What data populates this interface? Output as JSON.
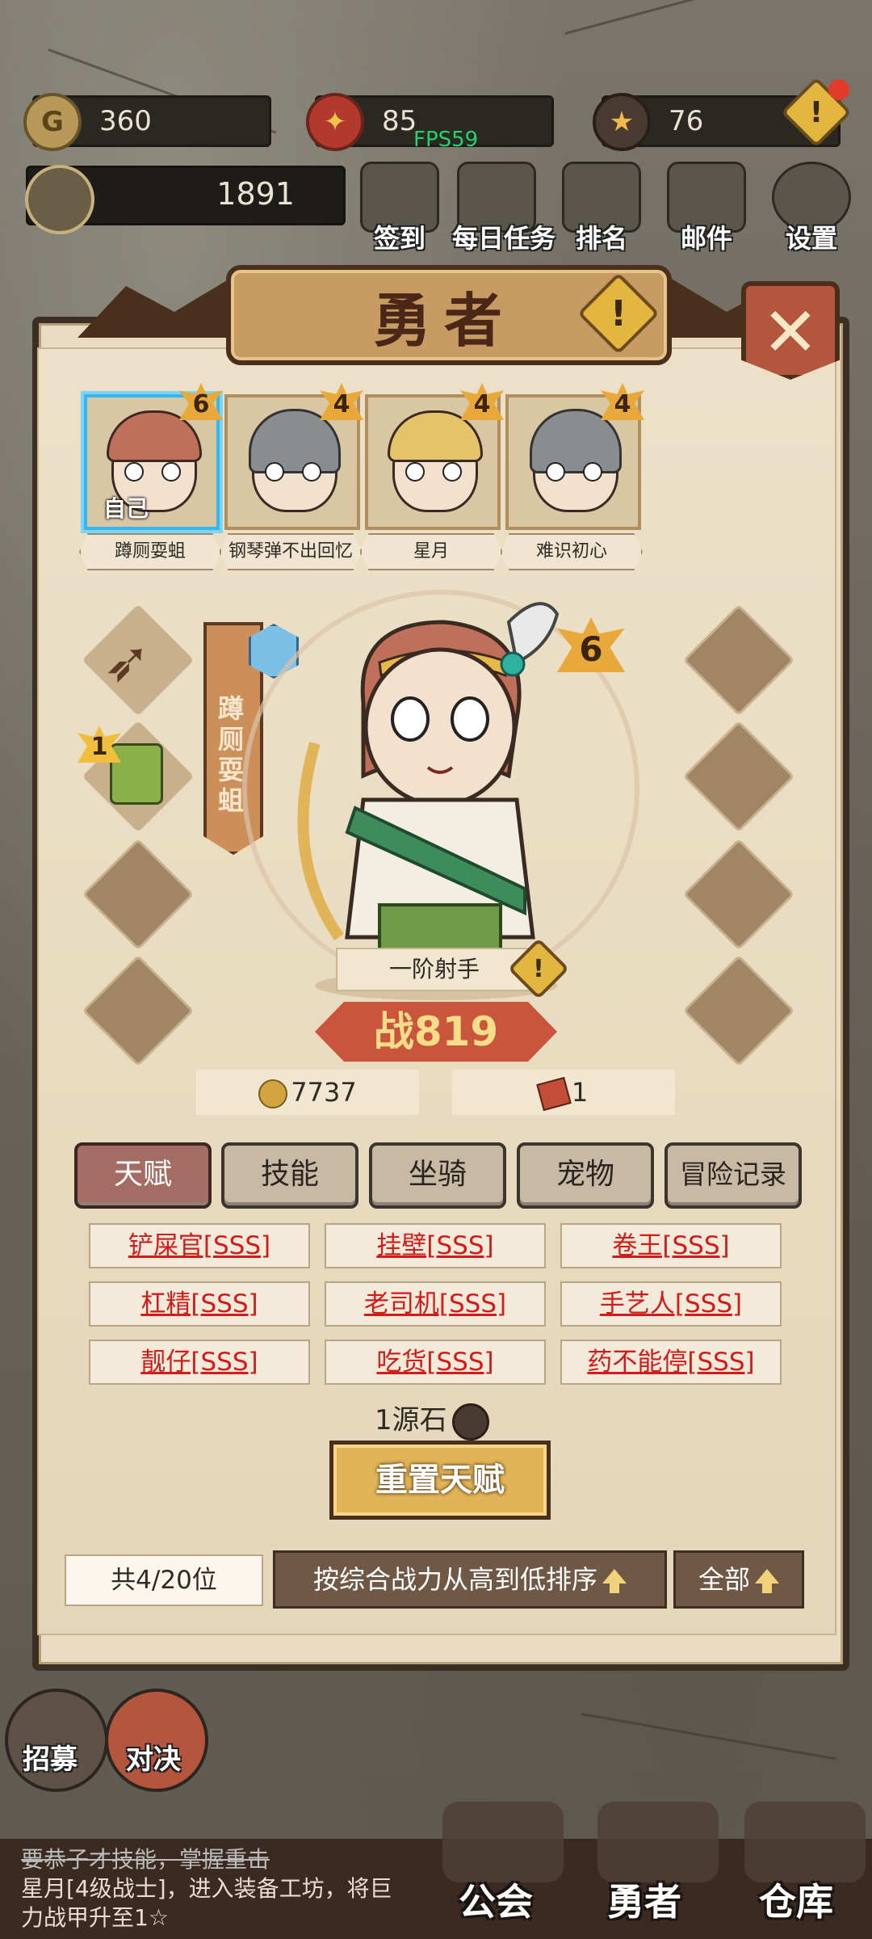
{
  "resources": {
    "gold": "360",
    "honor": "85",
    "stone": "76"
  },
  "fps": "FPS59",
  "total_power": "1891",
  "top_menu": [
    "签到",
    "每日任务",
    "排名",
    "邮件",
    "设置"
  ],
  "panel": {
    "title": "勇者",
    "close_icon": "close-icon"
  },
  "heroes": [
    {
      "name": "蹲厕耍蛆",
      "level": "6",
      "tag": "自己",
      "selected": true
    },
    {
      "name": "钢琴弹不出回忆",
      "level": "4",
      "selected": false
    },
    {
      "name": "星月",
      "level": "4",
      "selected": false
    },
    {
      "name": "难识初心",
      "level": "4",
      "selected": false
    }
  ],
  "equipment": {
    "bow_slot": "bow-icon",
    "armor_level": "1"
  },
  "hero_detail": {
    "banner_name": "蹲厕耍蛆",
    "level": "6",
    "class": "一阶射手",
    "battle_prefix": "战",
    "battle_power": "819",
    "gold": "7737",
    "scrolls": "1"
  },
  "tabs": [
    "天赋",
    "技能",
    "坐骑",
    "宠物",
    "冒险记录"
  ],
  "active_tab": "天赋",
  "talents": [
    "铲屎官[SSS]",
    "挂壁[SSS]",
    "卷王[SSS]",
    "杠精[SSS]",
    "老司机[SSS]",
    "手艺人[SSS]",
    "靓仔[SSS]",
    "吃货[SSS]",
    "药不能停[SSS]"
  ],
  "reset": {
    "cost": "1源石",
    "button": "重置天赋"
  },
  "footer": {
    "count": "共4/20位",
    "sort": "按综合战力从高到低排序",
    "filter": "全部"
  },
  "side_nav": [
    "招募",
    "对决"
  ],
  "message": {
    "line1": "要恭子才技能，掌握重击",
    "line2": "星月[4级战士]，进入装备工坊，将巨",
    "line3": "力战甲升至1☆"
  },
  "bottom_nav": [
    "公会",
    "勇者",
    "仓库"
  ],
  "colors": {
    "talent_red": "#d21c1c",
    "active_tab": "#a46c62",
    "selected_border": "#35b7ef"
  }
}
